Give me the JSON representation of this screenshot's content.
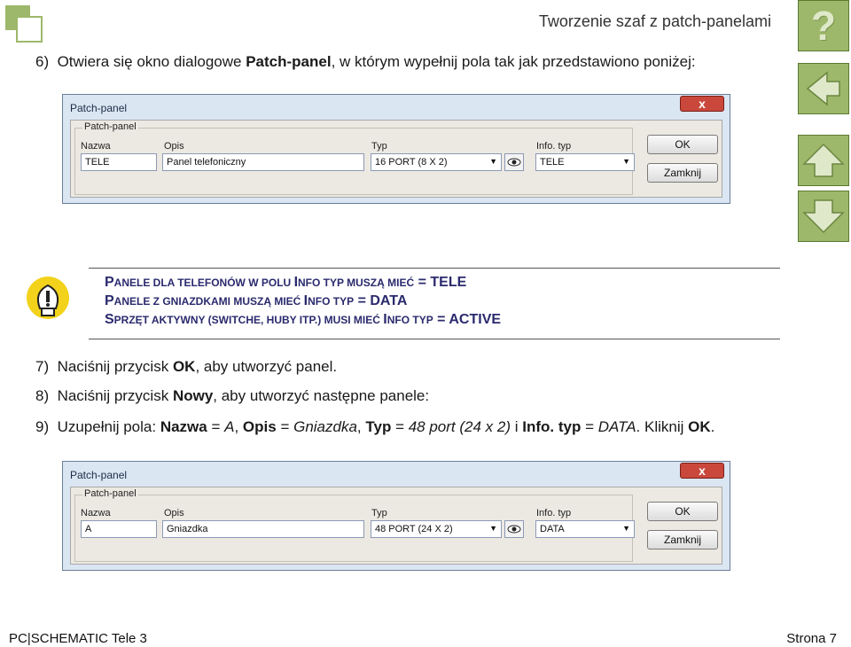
{
  "header": {
    "title": "Tworzenie szaf z patch-panelami",
    "help_glyph": "?"
  },
  "steps": {
    "s6": {
      "num": "6)",
      "pre": "Otwiera się okno dialogowe ",
      "bold": "Patch-panel",
      "post": ", w którym wypełnij pola tak jak przedstawiono poniżej:"
    },
    "s7": {
      "num": "7)",
      "pre": "Naciśnij przycisk ",
      "bold": "OK",
      "post": ", aby utworzyć panel."
    },
    "s8": {
      "num": "8)",
      "pre": "Naciśnij przycisk ",
      "bold": "Nowy",
      "post": ", aby utworzyć następne panele:"
    },
    "s9": {
      "num": "9)",
      "a": "Uzupełnij pola: ",
      "b1": "Nazwa",
      "a2": " = ",
      "i1": "A",
      "a3": ", ",
      "b2": "Opis",
      "a4": " = ",
      "i2": "Gniazdka",
      "a5": ", ",
      "b3": "Typ",
      "a6": " = ",
      "i3": "48 port (24 x 2)",
      "a7": " i ",
      "b4": "Info. typ",
      "a8": " = ",
      "i4": "DATA",
      "a9": ". Kliknij ",
      "b5": "OK",
      "a10": "."
    }
  },
  "tip": {
    "line1_a": "P",
    "line1_b": "ANELE DLA TELEFONÓW",
    "line1_c": " W POLU ",
    "line1_d": "I",
    "line1_e": "NFO TYP MUSZĄ MIEĆ",
    "line1_f": " = TELE",
    "line2_a": "P",
    "line2_b": "ANELE Z GNIAZDKAMI",
    "line2_c": " MUSZĄ MIEĆ ",
    "line2_d": "I",
    "line2_e": "NFO TYP",
    "line2_f": " = DATA",
    "line3_a": "S",
    "line3_b": "PRZĘT AKTYWNY (SWITCHE, HUBY ITP.)",
    "line3_c": " MUSI MIEĆ ",
    "line3_d": "I",
    "line3_e": "NFO TYP",
    "line3_f": " = ACTIVE"
  },
  "dialog1": {
    "title": "Patch-panel",
    "close": "x",
    "group": "Patch-panel",
    "labels": {
      "nazwa": "Nazwa",
      "opis": "Opis",
      "typ": "Typ",
      "info": "Info. typ"
    },
    "values": {
      "nazwa": "TELE",
      "opis": "Panel telefoniczny",
      "typ": "16 PORT (8 X 2)",
      "info": "TELE"
    },
    "ok": "OK",
    "close_btn": "Zamknij"
  },
  "dialog2": {
    "title": "Patch-panel",
    "close": "x",
    "group": "Patch-panel",
    "labels": {
      "nazwa": "Nazwa",
      "opis": "Opis",
      "typ": "Typ",
      "info": "Info. typ"
    },
    "values": {
      "nazwa": "A",
      "opis": "Gniazdka",
      "typ": "48 PORT (24 X 2)",
      "info": "DATA"
    },
    "ok": "OK",
    "close_btn": "Zamknij"
  },
  "footer": {
    "left": "PC|SCHEMATIC Tele 3",
    "right": "Strona 7"
  },
  "colors": {
    "accent": "#9db86a",
    "tip_text": "#2a2a6e",
    "dialog_frame": "#dbe6f3"
  },
  "icons": {
    "nav": [
      "help-icon",
      "back-arrow-icon",
      "up-arrow-icon",
      "down-arrow-icon"
    ],
    "tip": "lightbulb-icon",
    "preview": "eye-icon"
  }
}
